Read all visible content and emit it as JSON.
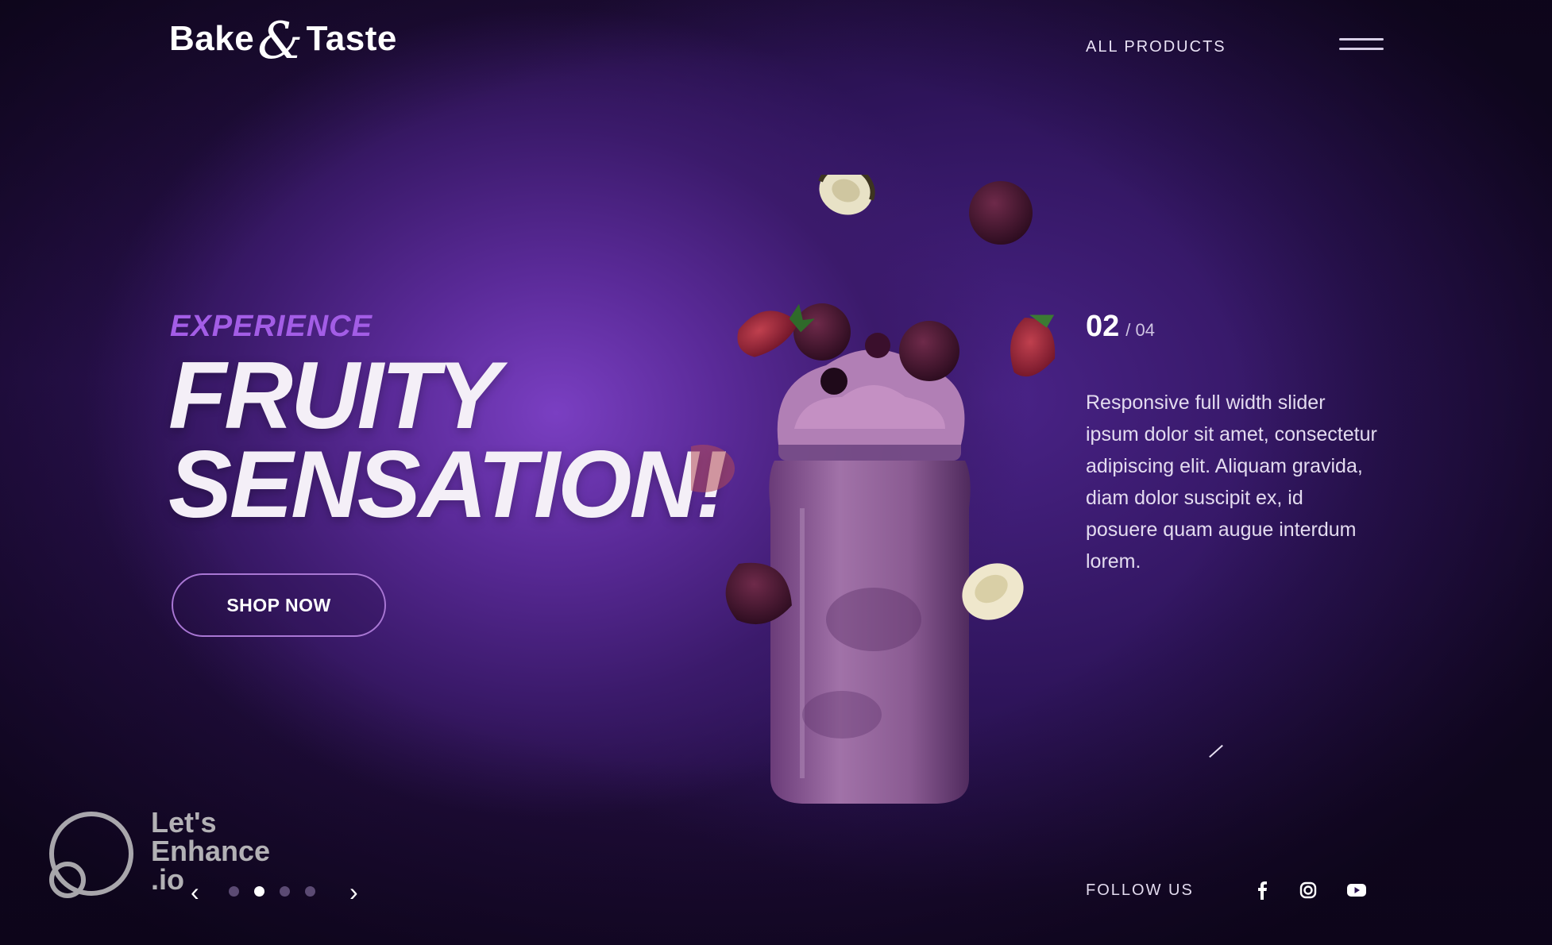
{
  "header": {
    "logo": {
      "left": "Bake",
      "amp": "&",
      "right": "Taste"
    },
    "nav_link": "ALL PRODUCTS",
    "menu_icon": "hamburger-icon"
  },
  "hero": {
    "eyebrow": "EXPERIENCE",
    "headline_line1": "FRUITY",
    "headline_line2": "SENSATION!",
    "cta": "SHOP NOW"
  },
  "slide": {
    "current": "02",
    "total": "/ 04",
    "description": "Responsive full width slider ipsum dolor sit amet, consectetur adipiscing elit. Aliquam gravida, diam dolor suscipit ex, id posuere quam augue interdum lorem."
  },
  "slider_controls": {
    "prev": "‹",
    "next": "›",
    "dots": 4,
    "active_dot": 2
  },
  "footer": {
    "follow_label": "FOLLOW US",
    "social": [
      "facebook-icon",
      "instagram-icon",
      "youtube-icon"
    ]
  },
  "watermark": {
    "line1": "Let's",
    "line2": "Enhance",
    "line3": ".io"
  },
  "colors": {
    "accent": "#a35de6",
    "background": "#2a1150",
    "button_border": "#a977d4"
  }
}
